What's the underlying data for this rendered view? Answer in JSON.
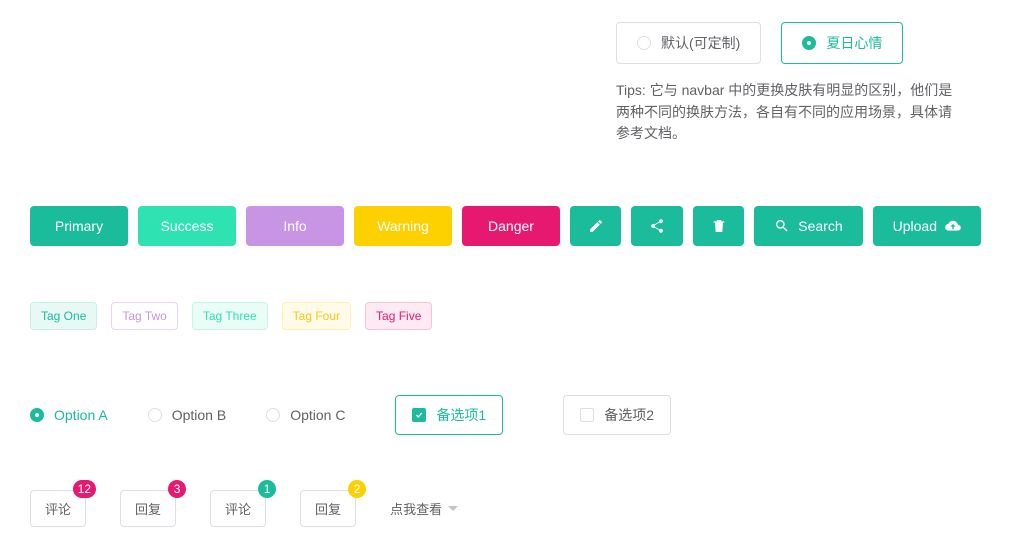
{
  "theme": {
    "default_label": "默认(可定制)",
    "summer_label": "夏日心情",
    "tips": "Tips: 它与 navbar 中的更换皮肤有明显的区别，他们是两种不同的换肤方法，各自有不同的应用场景，具体请参考文档。"
  },
  "buttons": {
    "primary": "Primary",
    "success": "Success",
    "info": "Info",
    "warning": "Warning",
    "danger": "Danger",
    "search": "Search",
    "upload": "Upload"
  },
  "tags": {
    "one": "Tag One",
    "two": "Tag Two",
    "three": "Tag Three",
    "four": "Tag Four",
    "five": "Tag Five"
  },
  "radios": {
    "a": "Option A",
    "b": "Option B",
    "c": "Option C"
  },
  "checks": {
    "opt1": "备选项1",
    "opt2": "备选项2"
  },
  "badges": {
    "comment": "评论",
    "reply": "回复",
    "c1": "12",
    "c2": "3",
    "c3": "1",
    "c4": "2"
  },
  "dropdown": {
    "label": "点我查看"
  }
}
